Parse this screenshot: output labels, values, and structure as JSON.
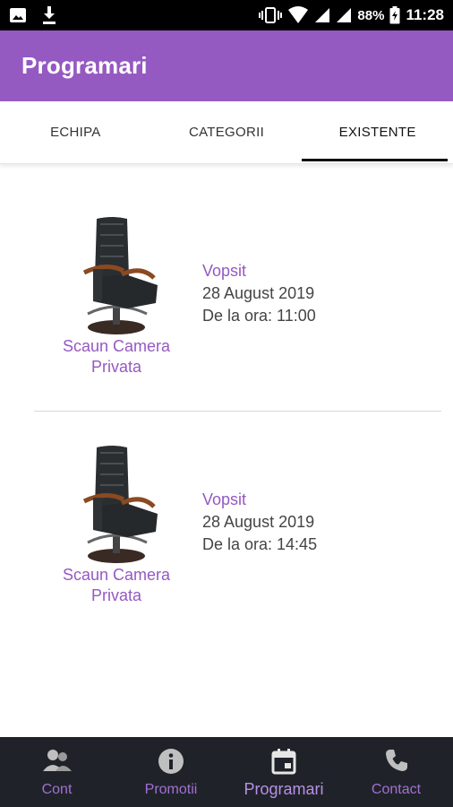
{
  "status_bar": {
    "battery_percent": "88%",
    "time": "11:28",
    "icons": [
      "image-icon",
      "download-icon",
      "vibrate-icon",
      "wifi-icon",
      "cell-signal-icon",
      "battery-charging-icon"
    ]
  },
  "app_bar": {
    "title": "Programari",
    "color": "#9559c2"
  },
  "tabs": [
    {
      "label": "ECHIPA",
      "active": false
    },
    {
      "label": "CATEGORII",
      "active": false
    },
    {
      "label": "EXISTENTE",
      "active": true
    }
  ],
  "appointments": [
    {
      "item_name": "Scaun Camera Privata",
      "service": "Vopsit",
      "date": "28 August 2019",
      "time": "De la ora: 11:00"
    },
    {
      "item_name": "Scaun Camera Privata",
      "service": "Vopsit",
      "date": "28 August 2019",
      "time": "De la ora: 14:45"
    }
  ],
  "bottom_nav": {
    "items": [
      {
        "label": "Cont",
        "icon": "account-icon",
        "active": false
      },
      {
        "label": "Promotii",
        "icon": "info-icon",
        "active": false
      },
      {
        "label": "Programari",
        "icon": "calendar-icon",
        "active": true
      },
      {
        "label": "Contact",
        "icon": "phone-icon",
        "active": false
      }
    ],
    "background": "#1f2329",
    "label_color": "#a46fd4"
  }
}
